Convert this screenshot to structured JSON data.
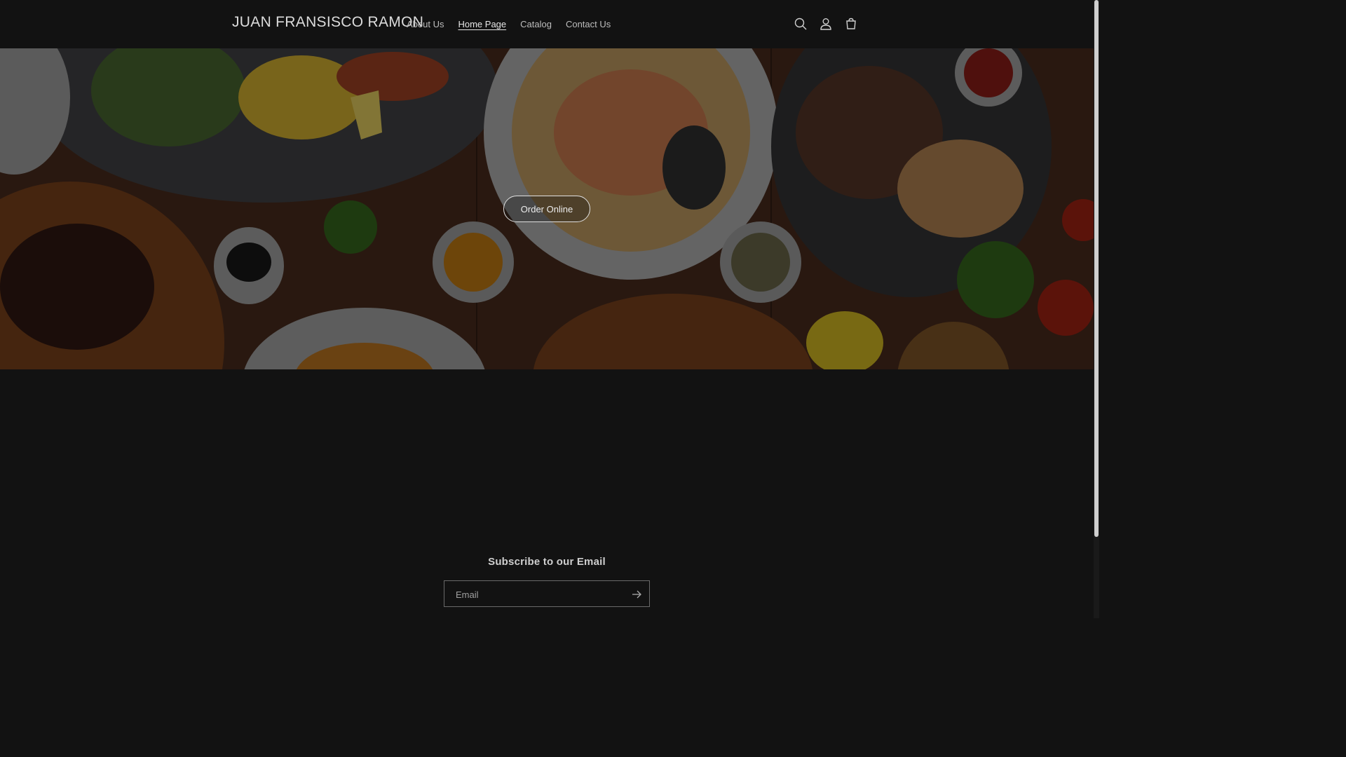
{
  "header": {
    "logo": "JUAN FRANSISCO RAMON",
    "nav": [
      {
        "label": "About Us"
      },
      {
        "label": "Home Page"
      },
      {
        "label": "Catalog"
      },
      {
        "label": "Contact Us"
      }
    ],
    "icons": [
      "search-icon",
      "account-icon",
      "cart-icon"
    ]
  },
  "hero": {
    "button_label": "Order Online"
  },
  "newsletter": {
    "title": "Subscribe to our Email",
    "email_placeholder": "Email",
    "submit_icon": "arrow-right-icon"
  },
  "colors": {
    "background": "#121212",
    "text": "#e6e6e6",
    "wood": "#3d2415"
  }
}
